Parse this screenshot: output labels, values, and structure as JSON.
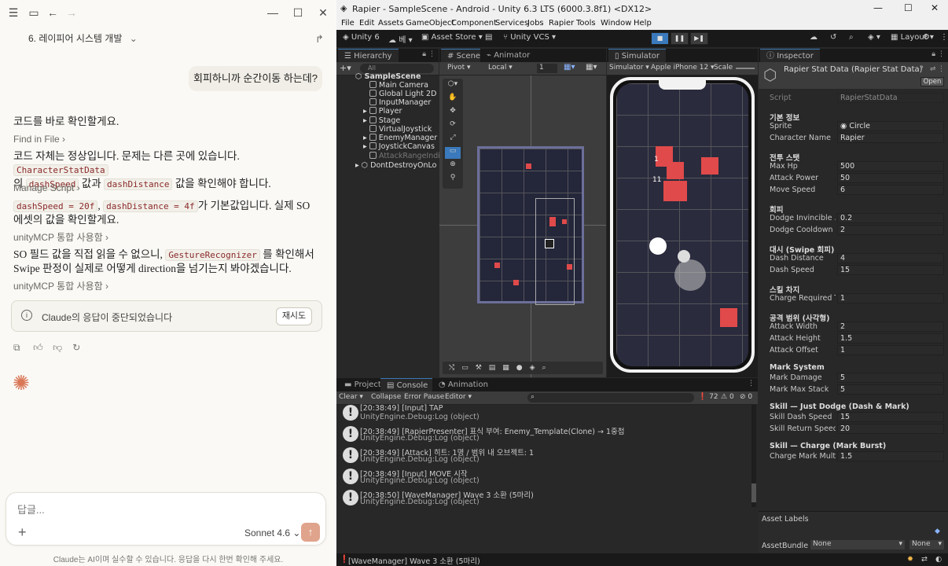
{
  "claude": {
    "chat_title": "6. 레이피어 시스템 개발",
    "user_message": "회피하니까 순간이동 하는데?",
    "para1": "코드를 바로 확인할게요.",
    "tool1": "Find in File",
    "para2_a": "코드 자체는 정상입니다. 문제는 다른 곳에 있습니다.",
    "para2_code1": "CharacterStatData",
    "para2_b": "의",
    "para2_code2": "dashSpeed",
    "para2_c": "값과",
    "para2_code3": "dashDistance",
    "para2_d": "값을 확인해야 합니다.",
    "tool2": "Manage Script",
    "para3_code1": "dashSpeed = 20f",
    "para3_code2": "dashDistance = 4f",
    "para3_a": "가 기본값입니다. 실제 SO 에셋의 값을 확인할게요.",
    "tool3": "unityMCP 통합 사용함",
    "para4_a": "SO 필드 값을 직접 읽을 수 없으니,",
    "para4_code": "GestureRecognizer",
    "para4_b": "를 확인해서 Swipe 판정이 실제로 어떻게 direction을 넘기는지 봐야겠습니다.",
    "tool4": "unityMCP 통합 사용함",
    "notice": "Claude의 응답이 중단되었습니다",
    "retry": "재시도",
    "composer_placeholder": "답글...",
    "model": "Sonnet 4.6",
    "disclaimer": "Claude는 AI이며 실수할 수 있습니다. 응답을 다시 한번 확인해 주세요."
  },
  "unity": {
    "window_title": "Rapier - SampleScene - Android - Unity 6.3 LTS (6000.3.8f1) <DX12>",
    "menu": [
      "File",
      "Edit",
      "Assets",
      "GameObject",
      "Component",
      "Services",
      "Jobs",
      "Rapier",
      "Tools",
      "Window",
      "Help"
    ],
    "toolbar": {
      "unity_label": "Unity 6",
      "account": "베",
      "asset_store": "Asset Store",
      "vcs": "Unity VCS",
      "layout": "Layout"
    },
    "hierarchy": {
      "tab": "Hierarchy",
      "search": "All",
      "scene": "SampleScene",
      "items": [
        "Main Camera",
        "Global Light 2D",
        "InputManager",
        "Player",
        "Stage",
        "VirtualJoystick",
        "EnemyManager",
        "JoystickCanvas",
        "AttackRangeIndica"
      ],
      "ddol": "DontDestroyOnLo"
    },
    "scene": {
      "tab": "Scene",
      "tab2": "Animator",
      "pivot": "Pivot",
      "local": "Local",
      "snap": "1"
    },
    "simulator": {
      "tab": "Simulator",
      "mode": "Simulator",
      "device": "Apple iPhone 12",
      "scale": "Scale",
      "label_a": "1",
      "label_b": "11"
    },
    "console": {
      "tabs": [
        "Project",
        "Console",
        "Animation"
      ],
      "clear": "Clear",
      "collapse": "Collapse",
      "error_pause": "Error Pause",
      "editor": "Editor",
      "count_msg": "72",
      "count_warn": "0",
      "count_err": "0",
      "logs": [
        {
          "line1": "[20:38:49] [Input] TAP",
          "line2": "UnityEngine.Debug:Log (object)"
        },
        {
          "line1": "[20:38:49] [RapierPresenter] 표식 부여: Enemy_Template(Clone) → 1중첩",
          "line2": "UnityEngine.Debug:Log (object)"
        },
        {
          "line1": "[20:38:49] [Attack] 히트: 1명 / 범위 내 오브젝트: 1",
          "line2": "UnityEngine.Debug:Log (object)"
        },
        {
          "line1": "[20:38:49] [Input] MOVE 시작",
          "line2": "UnityEngine.Debug:Log (object)"
        },
        {
          "line1": "[20:38:50] [WaveManager] Wave 3 소환 (5마리)",
          "line2": "UnityEngine.Debug:Log (object)"
        }
      ]
    },
    "inspector": {
      "tab": "Inspector",
      "asset_name": "Rapier Stat Data (Rapier Stat Data)",
      "open": "Open",
      "script_label": "Script",
      "script_value": "RapierStatData",
      "sections": [
        {
          "title": "기본 정보",
          "rows": [
            {
              "label": "Sprite",
              "value": "Circle"
            },
            {
              "label": "Character Name",
              "value": "Rapier"
            }
          ]
        },
        {
          "title": "전투 스탯",
          "rows": [
            {
              "label": "Max Hp",
              "value": "500"
            },
            {
              "label": "Attack Power",
              "value": "50"
            },
            {
              "label": "Move Speed",
              "value": "6"
            }
          ]
        },
        {
          "title": "회피",
          "rows": [
            {
              "label": "Dodge Invincible ...",
              "value": "0.2"
            },
            {
              "label": "Dodge Cooldown",
              "value": "2"
            }
          ]
        },
        {
          "title": "대시 (Swipe 회피)",
          "rows": [
            {
              "label": "Dash Distance",
              "value": "4"
            },
            {
              "label": "Dash Speed",
              "value": "15"
            }
          ]
        },
        {
          "title": "스킬 차지",
          "rows": [
            {
              "label": "Charge Required T...",
              "value": "1"
            }
          ]
        },
        {
          "title": "공격 범위 (사각형)",
          "rows": [
            {
              "label": "Attack Width",
              "value": "2"
            },
            {
              "label": "Attack Height",
              "value": "1.5"
            },
            {
              "label": "Attack Offset",
              "value": "1"
            }
          ]
        },
        {
          "title": "Mark System",
          "rows": [
            {
              "label": "Mark Damage",
              "value": "5"
            },
            {
              "label": "Mark Max Stack",
              "value": "5"
            }
          ]
        },
        {
          "title": "Skill — Just Dodge (Dash & Mark)",
          "rows": [
            {
              "label": "Skill Dash Speed",
              "value": "15"
            },
            {
              "label": "Skill Return Speed",
              "value": "20"
            }
          ]
        },
        {
          "title": "Skill — Charge (Mark Burst)",
          "rows": [
            {
              "label": "Charge Mark Multi...",
              "value": "1.5"
            }
          ]
        }
      ],
      "asset_labels": "Asset Labels",
      "asset_bundle": "AssetBundle",
      "bundle_value": "None",
      "bundle_variant": "None"
    },
    "status_message": "[WaveManager] Wave 3 소환 (5마리)"
  }
}
